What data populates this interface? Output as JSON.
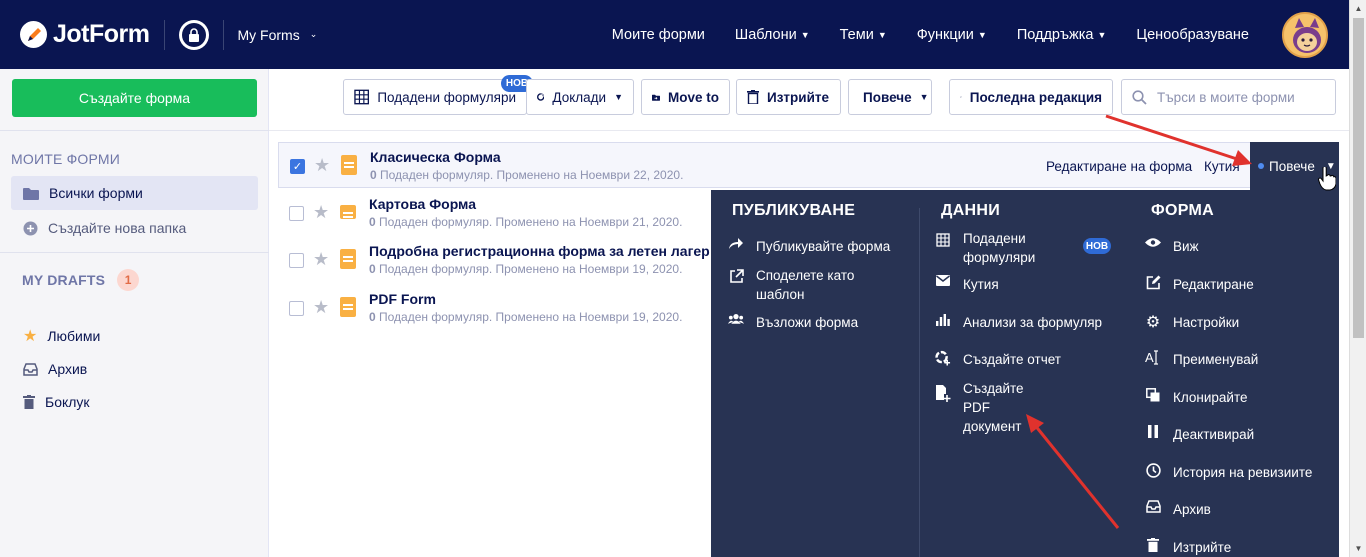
{
  "header": {
    "brand": "JotForm",
    "workspace_label": "My Forms",
    "nav": [
      "Моите форми",
      "Шаблони",
      "Теми",
      "Функции",
      "Поддръжка",
      "Ценообразуване"
    ]
  },
  "sidebar": {
    "create_label": "Създайте форма",
    "section_title": "МОИТЕ ФОРМИ",
    "all_forms": "Всички форми",
    "new_folder": "Създайте нова папка",
    "drafts_title": "MY DRAFTS",
    "drafts_count": "1",
    "favorites": "Любими",
    "archive": "Архив",
    "trash": "Боклук"
  },
  "toolbar": {
    "submissions": "Подадени формуляри",
    "new_badge": "НОВ",
    "reports": "Доклади",
    "move_to": "Move to",
    "delete": "Изтрийте",
    "more": "Повече",
    "sort": "Последна редакция",
    "search_placeholder": "Търси в моите форми"
  },
  "forms": [
    {
      "title": "Класическа Форма",
      "count": "0",
      "meta": " Подаден формуляр. Променено на Ноември 22, 2020.",
      "checked": true
    },
    {
      "title": "Картова Форма",
      "count": "0",
      "meta": " Подаден формуляр. Променено на Ноември 21, 2020.",
      "checked": false
    },
    {
      "title": "Подробна регистрационна форма за летен лагер",
      "count": "0",
      "meta": " Подаден формуляр. Променено на Ноември 19, 2020.",
      "checked": false
    },
    {
      "title": "PDF Form",
      "count": "0",
      "meta": " Подаден формуляр. Променено на Ноември 19, 2020.",
      "checked": false
    }
  ],
  "row_actions": {
    "edit": "Редактиране на форма",
    "inbox": "Кутия",
    "more": "Повече"
  },
  "dropdown": {
    "publish_title": "ПУБЛИКУВАНЕ",
    "publish_items": [
      "Публикувайте форма",
      "Споделете като шаблон",
      "Възложи форма"
    ],
    "data_title": "ДАННИ",
    "data_items": [
      "Подадени формуляри",
      "Кутия",
      "Анализи за формуляр",
      "Създайте отчет",
      "Създайте PDF документ"
    ],
    "data_new_badge": "НОВ",
    "form_title": "ФОРМА",
    "form_items": [
      "Виж",
      "Редактиране",
      "Настройки",
      "Преименувай",
      "Клонирайте",
      "Деактивирай",
      "История на ревизиите",
      "Архив",
      "Изтрийте"
    ]
  },
  "colors": {
    "navy": "#0a1551",
    "panel": "#283353",
    "green": "#18bd5b",
    "accent_blue": "#2f6bd6",
    "annotation_red": "#e0322d"
  }
}
